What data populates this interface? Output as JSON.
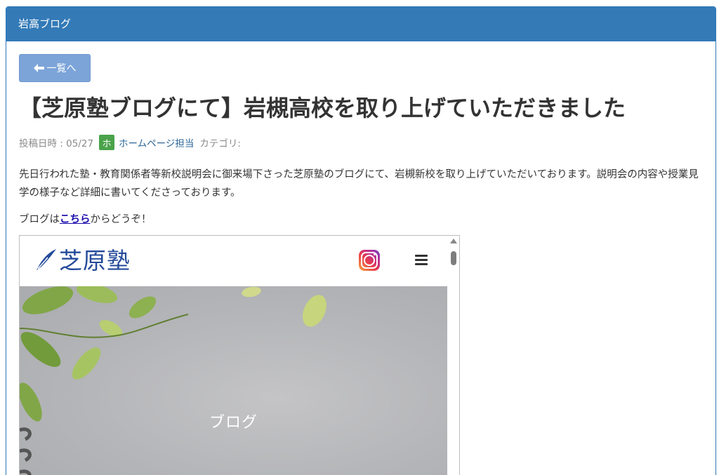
{
  "header": {
    "title": "岩高ブログ"
  },
  "back_button": {
    "label": "一覧へ",
    "icon": "arrow-left-icon"
  },
  "post": {
    "title": "【芝原塾ブログにて】岩槻高校を取り上げていただきました",
    "date_label": "投稿日時 : 05/27",
    "author_initial": "ホ",
    "author_name": "ホームページ担当",
    "category_label": "カテゴリ:",
    "body": "先日行われた塾・教育関係者等新校説明会に御来場下さった芝原塾のブログにて、岩槻新校を取り上げていただいております。説明会の内容や授業見学の様子など詳細に書いてくださっております。",
    "link_prefix": "ブログは",
    "link_text": "こちら",
    "link_suffix": "からどうぞ！"
  },
  "embed": {
    "logo_text": "芝原塾",
    "logo_icon": "quill-pen-icon",
    "instagram_icon": "instagram-icon",
    "menu_icon": "hamburger-menu-icon",
    "hero_title": "ブログ"
  },
  "colors": {
    "header_bg": "#337ab7",
    "button_bg": "#7ca4d8",
    "author_badge": "#4aa34a",
    "link": "#1a0dab",
    "logo": "#234a9a"
  }
}
